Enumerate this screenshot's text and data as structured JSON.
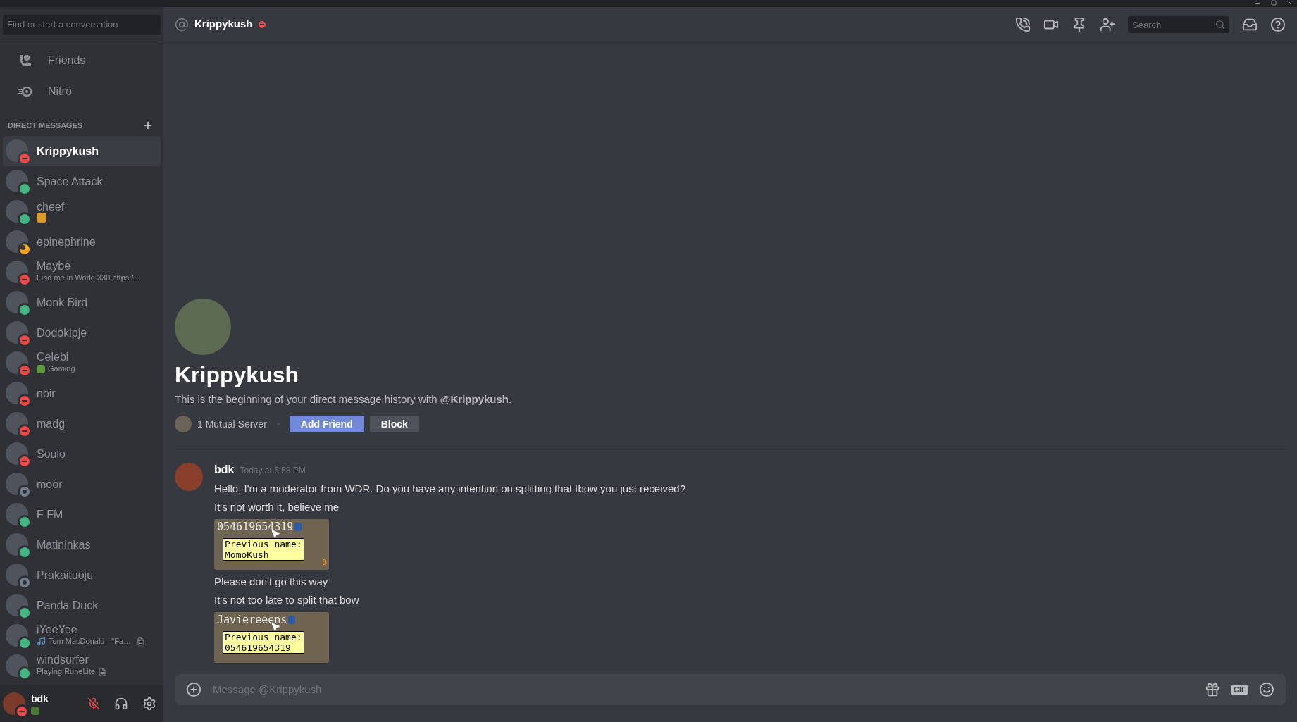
{
  "sidebar": {
    "search": {
      "placeholder": "Find or start a conversation"
    },
    "nav": [
      {
        "kind": "friends",
        "label": "Friends"
      },
      {
        "kind": "nitro",
        "label": "Nitro"
      }
    ],
    "dm_header": "DIRECT MESSAGES",
    "dms": [
      {
        "name": "Krippykush",
        "color": "#f04747",
        "selected": true
      },
      {
        "name": "Space Attack",
        "color": "#43b581",
        "selected": false
      },
      {
        "name": "cheef",
        "color": "#43b581",
        "selected": false,
        "activity": {
          "kind": "emoji"
        }
      },
      {
        "name": "epinephrine",
        "color": "#faa61a",
        "selected": false
      },
      {
        "name": "Maybe",
        "color": "#f04747",
        "selected": false,
        "activity": {
          "kind": "text",
          "text": "Find me in World 330 https:/…"
        }
      },
      {
        "name": "Monk Bird",
        "color": "#43b581",
        "selected": false
      },
      {
        "name": "Dodokipje",
        "color": "#f04747",
        "selected": false
      },
      {
        "name": "Celebi",
        "color": "#f04747",
        "selected": false,
        "activity": {
          "kind": "status",
          "text": "Gaming"
        }
      },
      {
        "name": "noir",
        "color": "#f04747",
        "selected": false
      },
      {
        "name": "madg",
        "color": "#f04747",
        "selected": false
      },
      {
        "name": "Soulo",
        "color": "#f04747",
        "selected": false
      },
      {
        "name": "moor",
        "color": "#747f8d",
        "selected": false
      },
      {
        "name": "F FM",
        "color": "#43b581",
        "selected": false
      },
      {
        "name": "Matininkas",
        "color": "#43b581",
        "selected": false
      },
      {
        "name": "Prakaituoju",
        "color": "#747f8d",
        "selected": false
      },
      {
        "name": "Panda Duck",
        "color": "#43b581",
        "selected": false
      },
      {
        "name": "iYeeYee",
        "color": "#43b581",
        "selected": false,
        "activity": {
          "kind": "listening",
          "text": "Tom MacDonald - \"Fa…"
        }
      },
      {
        "name": "windsurfer",
        "color": "#43b581",
        "selected": false,
        "activity": {
          "kind": "playing",
          "text": "Playing RuneLite"
        }
      }
    ],
    "user": {
      "name": "bdk",
      "color": "#f04747"
    }
  },
  "header": {
    "name": "Krippykush",
    "color": "#f04747",
    "search": {
      "placeholder": "Search"
    }
  },
  "intro": {
    "name": "Krippykush",
    "description": "This is the beginning of your direct message history with **@Krippykush**.",
    "mutual": "1 Mutual Server",
    "buttons": [
      {
        "kind": "primary",
        "label": "Add Friend"
      },
      {
        "kind": "secondary",
        "label": "Block"
      }
    ]
  },
  "message_group": {
    "author": "bdk",
    "time": "Today at 5:58 PM",
    "items": [
      {
        "kind": "text",
        "text": "Hello, I'm a moderator from WDR. Do you have any intention on splitting that tbow you just received?"
      },
      {
        "kind": "text",
        "text": "It's not worth it, believe me"
      },
      {
        "kind": "image",
        "player": "054619654319",
        "tooltip": [
          "Previous name:",
          "MomoKush"
        ],
        "corner": "D"
      },
      {
        "kind": "text",
        "text": "Please don't go this way"
      },
      {
        "kind": "text",
        "text": "It's not too late to split that bow"
      },
      {
        "kind": "image",
        "player": "Javiereeens",
        "tooltip": [
          "Previous name:",
          "054619654319"
        ]
      }
    ]
  },
  "composer": {
    "placeholder": "Message @Krippykush",
    "gif": "GIF"
  }
}
